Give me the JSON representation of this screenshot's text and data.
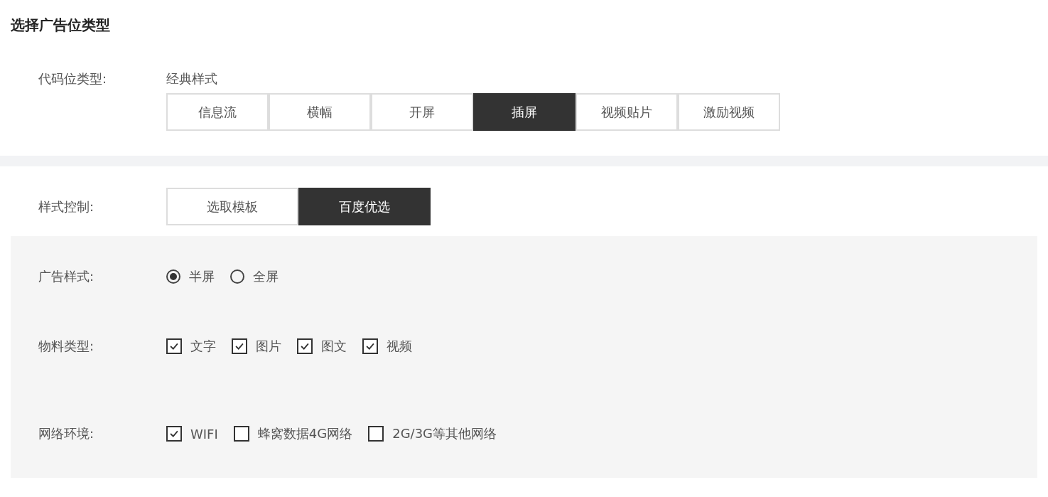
{
  "title": "选择广告位类型",
  "code_type": {
    "label": "代码位类型:",
    "value": "经典样式",
    "tabs": [
      {
        "label": "信息流",
        "selected": false
      },
      {
        "label": "横幅",
        "selected": false
      },
      {
        "label": "开屏",
        "selected": false
      },
      {
        "label": "插屏",
        "selected": true
      },
      {
        "label": "视频贴片",
        "selected": false
      },
      {
        "label": "激励视频",
        "selected": false
      }
    ]
  },
  "style_control": {
    "label": "样式控制:",
    "options": [
      {
        "label": "选取模板",
        "selected": false
      },
      {
        "label": "百度优选",
        "selected": true
      }
    ]
  },
  "ad_style": {
    "label": "广告样式:",
    "options": [
      {
        "label": "半屏",
        "selected": true
      },
      {
        "label": "全屏",
        "selected": false
      }
    ]
  },
  "material_type": {
    "label": "物料类型:",
    "options": [
      {
        "label": "文字",
        "checked": true
      },
      {
        "label": "图片",
        "checked": true
      },
      {
        "label": "图文",
        "checked": true
      },
      {
        "label": "视频",
        "checked": true
      }
    ]
  },
  "network": {
    "label": "网络环境:",
    "options": [
      {
        "label": "WIFI",
        "checked": true
      },
      {
        "label": "蜂窝数据4G网络",
        "checked": false
      },
      {
        "label": "2G/3G等其他网络",
        "checked": false
      }
    ]
  }
}
